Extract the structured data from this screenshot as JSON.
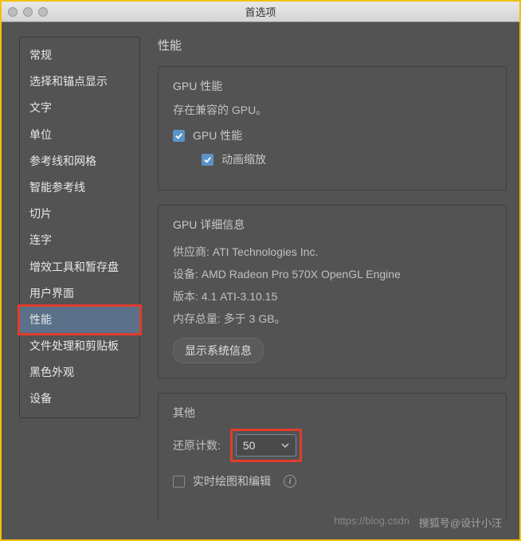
{
  "window": {
    "title": "首选项"
  },
  "sidebar": {
    "items": [
      "常规",
      "选择和锚点显示",
      "文字",
      "单位",
      "参考线和网格",
      "智能参考线",
      "切片",
      "连字",
      "增效工具和暂存盘",
      "用户界面",
      "性能",
      "文件处理和剪贴板",
      "黑色外观",
      "设备"
    ],
    "selected_index": 10,
    "highlighted_index": 10
  },
  "main": {
    "heading": "性能",
    "gpu_panel": {
      "title": "GPU 性能",
      "status": "存在兼容的 GPU。",
      "gpu_checkbox": {
        "label": "GPU 性能",
        "checked": true
      },
      "anim_checkbox": {
        "label": "动画缩放",
        "checked": true
      }
    },
    "details_panel": {
      "title": "GPU 详细信息",
      "vendor_label": "供应商:",
      "vendor_value": "ATI Technologies Inc.",
      "device_label": "设备:",
      "device_value": "AMD Radeon Pro 570X OpenGL Engine",
      "version_label": "版本:",
      "version_value": "4.1 ATI-3.10.15",
      "memory_label": "内存总量:",
      "memory_value": "多于 3 GB。",
      "show_info_btn": "显示系统信息"
    },
    "other_panel": {
      "title": "其他",
      "undo_label": "还原计数:",
      "undo_value": "50",
      "realtime_checkbox": {
        "label": "实时绘图和编辑",
        "checked": false
      }
    }
  },
  "watermarks": {
    "url": "https://blog.csdn",
    "text": "搜狐号@设计小汪"
  }
}
